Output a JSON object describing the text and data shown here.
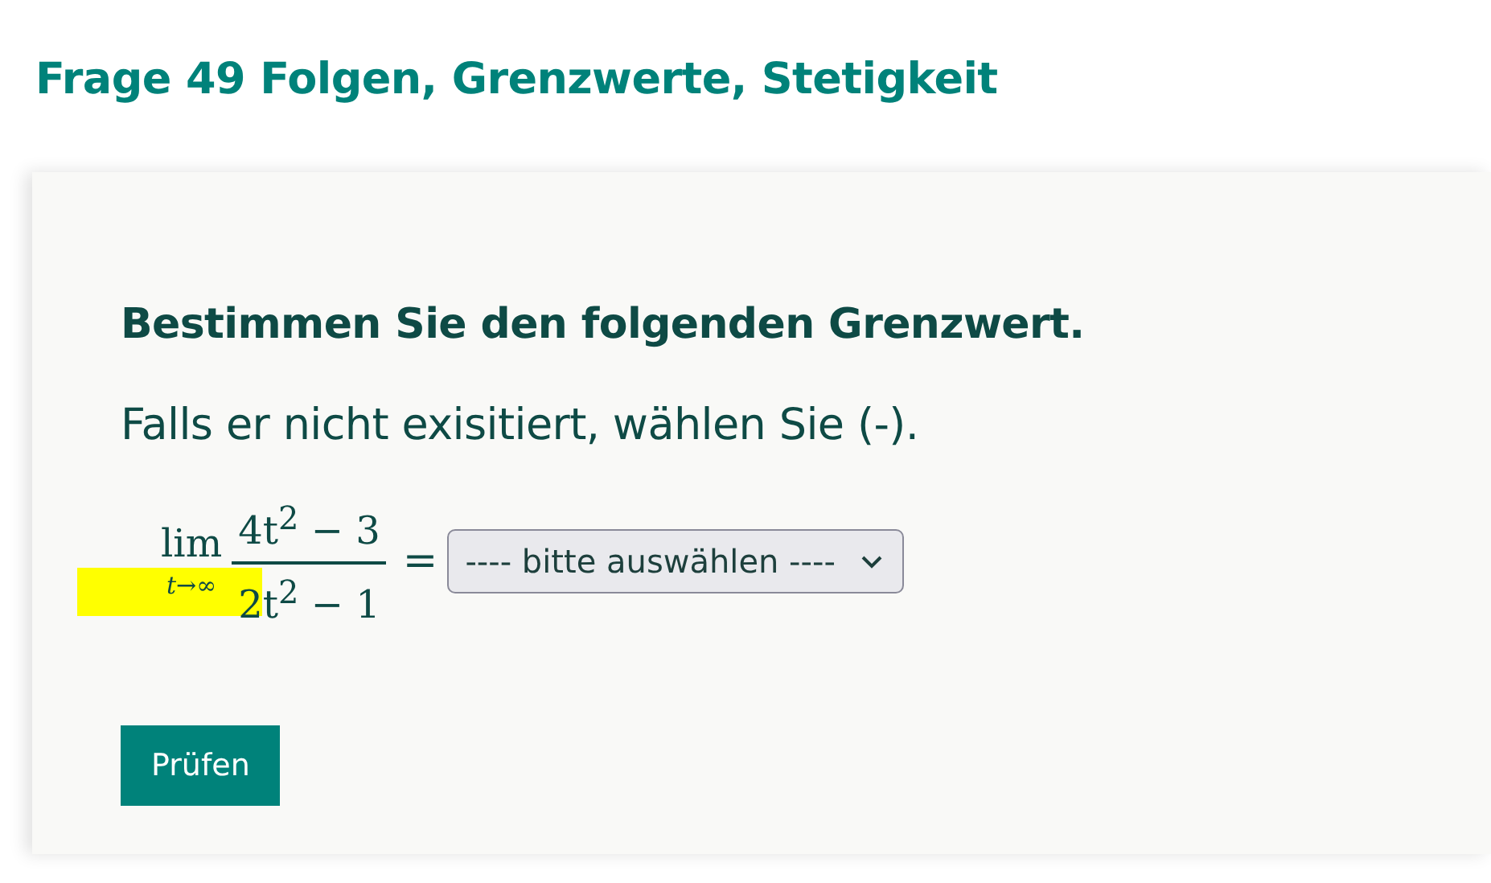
{
  "title": "Frage 49 Folgen, Grenzwerte, Stetigkeit",
  "question": {
    "heading": "Bestimmen Sie den folgenden Grenzwert.",
    "instruction": "Falls er nicht exisitiert, wählen Sie (-).",
    "formula": {
      "operator": "lim",
      "subscript": "*t*→∞",
      "numerator": "4t$^{2}$ − 3",
      "denominator": "2t$^{2}$ − 1",
      "relation": "="
    },
    "answer_select": {
      "value": "---- bitte auswählen ----"
    },
    "highlight": true
  },
  "buttons": [
    "Prüfen"
  ]
}
